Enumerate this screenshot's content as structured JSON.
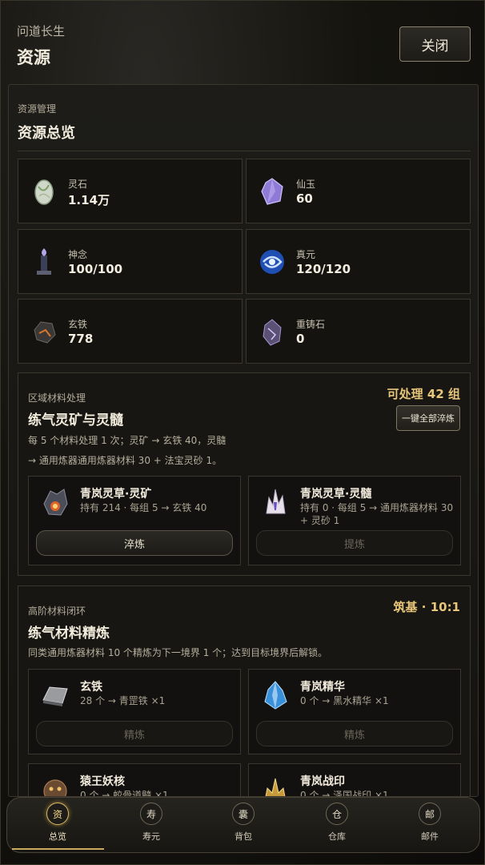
{
  "header": {
    "app_name": "问道长生",
    "title": "资源",
    "close_label": "关闭"
  },
  "overview": {
    "section_label": "资源管理",
    "section_title": "资源总览",
    "resources": [
      {
        "name": "灵石",
        "value": "1.14万",
        "icon": "spirit-stone-icon"
      },
      {
        "name": "仙玉",
        "value": "60",
        "icon": "immortal-jade-icon"
      },
      {
        "name": "神念",
        "value": "100/100",
        "icon": "divine-sense-icon"
      },
      {
        "name": "真元",
        "value": "120/120",
        "icon": "true-essence-icon"
      },
      {
        "name": "玄铁",
        "value": "778",
        "icon": "dark-iron-icon"
      },
      {
        "name": "重铸石",
        "value": "0",
        "icon": "reforge-stone-icon"
      }
    ]
  },
  "regional": {
    "section_label": "区域材料处理",
    "section_title": "练气灵矿与灵髓",
    "processable": "可处理 42 组",
    "one_key_label": "一键全部淬炼",
    "desc_line1": "每 5 个材料处理 1 次；灵矿 → 玄铁 40，灵髓",
    "desc_line2": "→ 通用炼器通用炼器材料 30 + 法宝灵砂 1。",
    "items": [
      {
        "name": "青岚灵草·灵矿",
        "info": "持有 214 · 每组 5 → 玄铁 40",
        "button": "淬炼"
      },
      {
        "name": "青岚灵草·灵髓",
        "info": "持有 0 · 每组 5 → 通用炼器材料 30 + 灵砂 1",
        "button": "提炼"
      }
    ]
  },
  "refine": {
    "section_label": "高阶材料闭环",
    "section_title": "练气材料精炼",
    "realm": "筑基 · 10:1",
    "desc": "同类通用炼器材料 10 个精炼为下一境界 1 个；达到目标境界后解锁。",
    "items": [
      {
        "name": "玄铁",
        "info": "28 个 → 青罡铁 ×1",
        "button": "精炼"
      },
      {
        "name": "青岚精华",
        "info": "0 个 → 黑水精华 ×1",
        "button": "精炼"
      },
      {
        "name": "猿王妖核",
        "info": "0 个 → 蛟骨道髓 ×1"
      },
      {
        "name": "青岚战印",
        "info": "0 个 → 泽国战印 ×1"
      }
    ]
  },
  "nav": [
    {
      "badge": "资",
      "label": "总览"
    },
    {
      "badge": "寿",
      "label": "寿元"
    },
    {
      "badge": "囊",
      "label": "背包"
    },
    {
      "badge": "仓",
      "label": "仓库"
    },
    {
      "badge": "邮",
      "label": "邮件"
    }
  ],
  "colors": {
    "accent_gold": "#e7c57a",
    "panel_border": "#3b372e",
    "background": "#0e0d0b"
  }
}
